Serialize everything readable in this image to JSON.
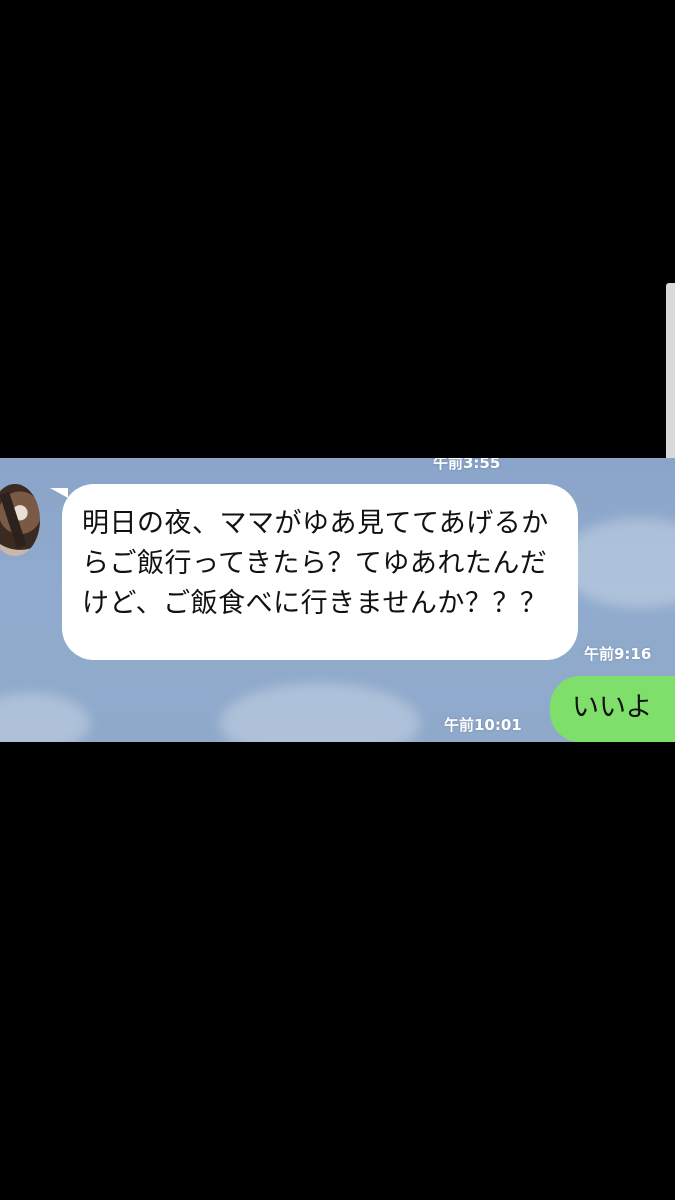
{
  "chat": {
    "timestamp_top": "午前3:55",
    "incoming": {
      "text": "明日の夜、ママがゆあ見ててあげるからご飯行ってきたら？てゆあれたんだけど、ご飯食べに行きませんか？？？",
      "time": "午前9:16"
    },
    "outgoing": {
      "text": "いいよ",
      "time": "午前10:01"
    }
  },
  "colors": {
    "page_background": "#000000",
    "chat_background": "#8aa5c9",
    "incoming_bubble": "#ffffff",
    "outgoing_bubble": "#7ee06b",
    "timestamp_text": "#ffffff"
  },
  "icons": {
    "avatar": "user-avatar-photo"
  }
}
